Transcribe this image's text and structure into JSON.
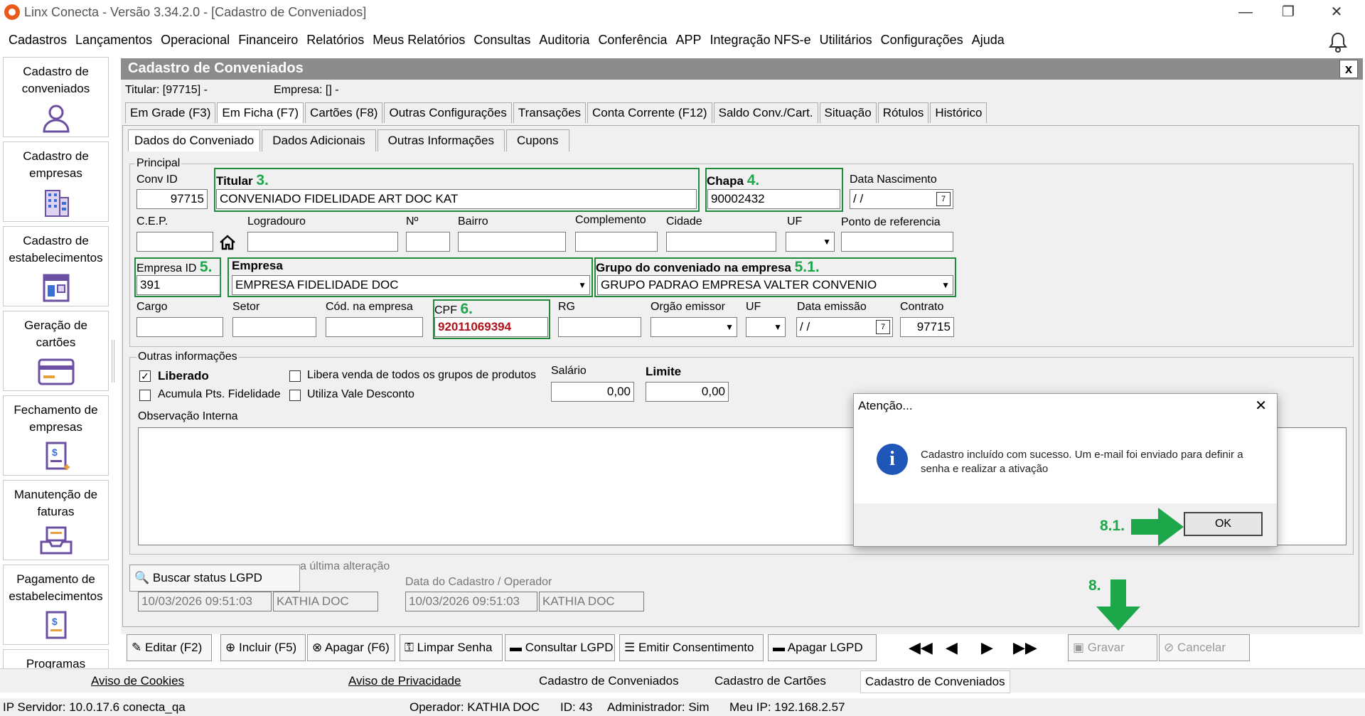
{
  "window": {
    "title": "Linx Conecta - Versão 3.34.2.0 - [Cadastro de Conveniados]"
  },
  "menu": [
    "Cadastros",
    "Lançamentos",
    "Operacional",
    "Financeiro",
    "Relatórios",
    "Meus Relatórios",
    "Consultas",
    "Auditoria",
    "Conferência",
    "APP",
    "Integração NFS-e",
    "Utilitários",
    "Configurações",
    "Ajuda"
  ],
  "nav": [
    {
      "label": "Cadastro de conveniados",
      "icon": "user-icon"
    },
    {
      "label": "Cadastro de empresas",
      "icon": "building-icon"
    },
    {
      "label": "Cadastro de estabelecimentos",
      "icon": "store-icon"
    },
    {
      "label": "Geração de cartões",
      "icon": "card-icon"
    },
    {
      "label": "Fechamento de empresas",
      "icon": "invoice-icon"
    },
    {
      "label": "Manutenção de faturas",
      "icon": "tray-icon"
    },
    {
      "label": "Pagamento de estabelecimentos",
      "icon": "payment-icon"
    },
    {
      "label": "Programas",
      "icon": "program-icon"
    }
  ],
  "panel": {
    "title": "Cadastro de Conveniados",
    "close": "x",
    "titular": "Titular: [97715] -",
    "empresa": "Empresa: [] -"
  },
  "tabs": [
    "Em Grade (F3)",
    "Em Ficha (F7)",
    "Cartões (F8)",
    "Outras Configurações",
    "Transações",
    "Conta Corrente (F12)",
    "Saldo Conv./Cart.",
    "Situação",
    "Rótulos",
    "Histórico"
  ],
  "subtabs": [
    "Dados do Conveniado",
    "Dados Adicionais",
    "Outras Informações",
    "Cupons"
  ],
  "principal": {
    "group": "Principal",
    "conv_id_label": "Conv ID",
    "conv_id": "97715",
    "titular_label": "Titular",
    "titular_num": "3.",
    "titular": "CONVENIADO FIDELIDADE ART DOC KAT",
    "chapa_label": "Chapa",
    "chapa_num": "4.",
    "chapa": "90002432",
    "nasc_label": "Data Nascimento",
    "nasc": "/ /",
    "cep_label": "C.E.P.",
    "logradouro_label": "Logradouro",
    "numero_label": "Nº",
    "bairro_label": "Bairro",
    "complemento_label": "Complemento",
    "cidade_label": "Cidade",
    "uf_label": "UF",
    "ref_label": "Ponto de referencia",
    "empresa_id_label": "Empresa ID",
    "empresa_id_num": "5.",
    "empresa_id": "391",
    "empresa_label": "Empresa",
    "empresa": "EMPRESA FIDELIDADE DOC",
    "grupo_label": "Grupo do conveniado na empresa",
    "grupo_num": "5.1.",
    "grupo": "GRUPO PADRAO EMPRESA VALTER CONVENIO",
    "cargo_label": "Cargo",
    "setor_label": "Setor",
    "cod_label": "Cód. na empresa",
    "cpf_label": "CPF",
    "cpf_num": "6.",
    "cpf": "92011069394",
    "rg_label": "RG",
    "orgao_label": "Orgão emissor",
    "uf2_label": "UF",
    "emissao_label": "Data emissão",
    "emissao": "/ /",
    "contrato_label": "Contrato",
    "contrato": "97715"
  },
  "outras": {
    "group": "Outras informações",
    "liberado": "Liberado",
    "acumula": "Acumula Pts. Fidelidade",
    "libera": "Libera venda de todos os grupos de produtos",
    "vale": "Utiliza Vale Desconto",
    "salario_label": "Salário",
    "salario": "0,00",
    "limite_label": "Limite",
    "limite": "0,00",
    "obs_label": "Observação Interna"
  },
  "lgpd": {
    "button": "Buscar status LGPD",
    "last_change": "a última alteração",
    "date1": "10/03/2026 09:51:03",
    "op1": "KATHIA DOC",
    "cad_label": "Data do Cadastro / Operador",
    "date2": "10/03/2026 09:51:03",
    "op2": "KATHIA DOC"
  },
  "toolbar": {
    "editar": "Editar (F2)",
    "incluir": "Incluir (F5)",
    "apagar": "Apagar (F6)",
    "limpar": "Limpar Senha",
    "consultar": "Consultar LGPD",
    "emitir": "Emitir Consentimento",
    "apagar_lgpd": "Apagar LGPD",
    "gravar": "Gravar",
    "cancelar": "Cancelar",
    "step8": "8."
  },
  "dialog": {
    "title": "Atenção...",
    "message": "Cadastro incluído com sucesso. Um e-mail foi enviado para definir a senha e realizar a ativação",
    "ok": "OK",
    "step": "8.1."
  },
  "footer": [
    "Aviso de Cookies",
    "Aviso de Privacidade",
    "Cadastro de Conveniados",
    "Cadastro de Cartões",
    "Cadastro de Conveniados"
  ],
  "status": {
    "ip": "IP Servidor: 10.0.17.6 conecta_qa",
    "operador": "Operador: KATHIA DOC",
    "id": "ID: 43",
    "admin": "Administrador: Sim",
    "meuip": "Meu IP: 192.168.2.57"
  },
  "colors": {
    "accent_green": "#1ea64a",
    "header_gray": "#8c8c8c",
    "cpf_red": "#b0121b"
  }
}
